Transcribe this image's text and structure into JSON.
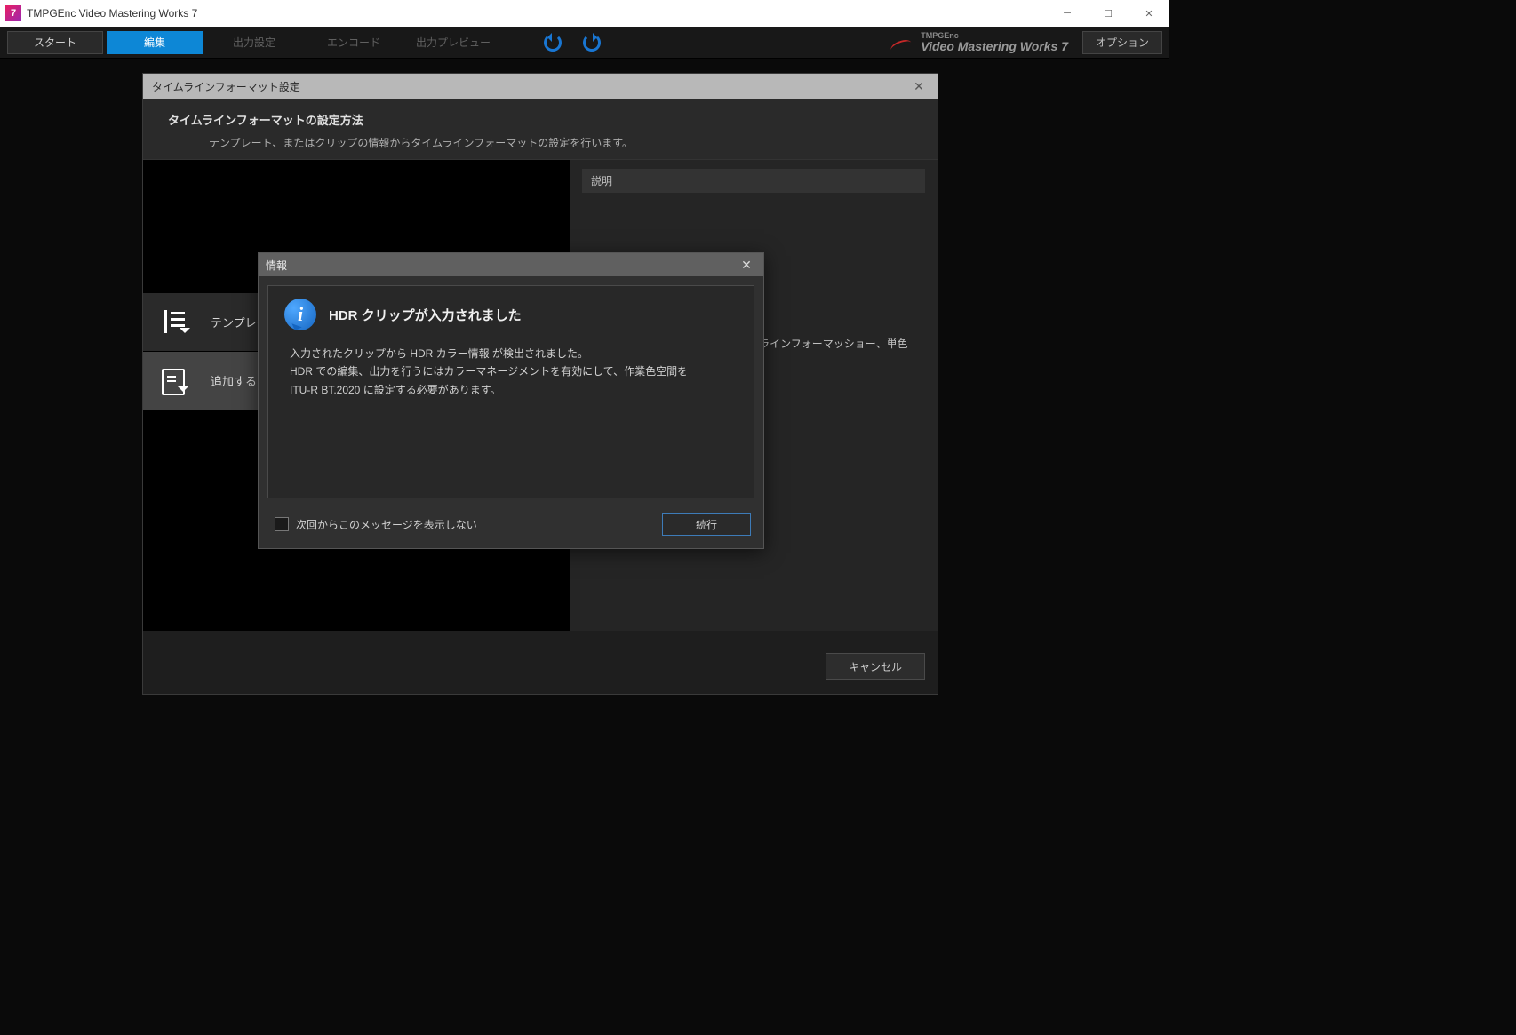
{
  "window": {
    "title": "TMPGEnc Video Mastering Works 7"
  },
  "toolbar": {
    "tabs": {
      "start": "スタート",
      "edit": "編集",
      "output_settings": "出力設定",
      "encode": "エンコード",
      "output_preview": "出力プレビュー"
    },
    "option": "オプション",
    "brand_top": "TMPGEnc",
    "brand_bottom": "Video Mastering Works 7"
  },
  "format_dialog": {
    "title": "タイムラインフォーマット設定",
    "header_title": "タイムラインフォーマットの設定方法",
    "header_desc": "テンプレート、またはクリップの情報からタイムラインフォーマットの設定を行います。",
    "items": {
      "template": "テンプレー",
      "add_clip": "追加する"
    },
    "desc_header": "説明",
    "desc_body": "。追加するクリップ（複ら、タイムラインフォーマッショー、単色クリップからは",
    "cancel": "キャンセル"
  },
  "info_modal": {
    "title": "情報",
    "heading": "HDR クリップが入力されました",
    "line1": "入力されたクリップから HDR カラー情報 が検出されました。",
    "line2": "HDR での編集、出力を行うにはカラーマネージメントを有効にして、作業色空間を",
    "line3": "ITU-R BT.2020 に設定する必要があります。",
    "checkbox_label": "次回からこのメッセージを表示しない",
    "continue": "続行"
  }
}
